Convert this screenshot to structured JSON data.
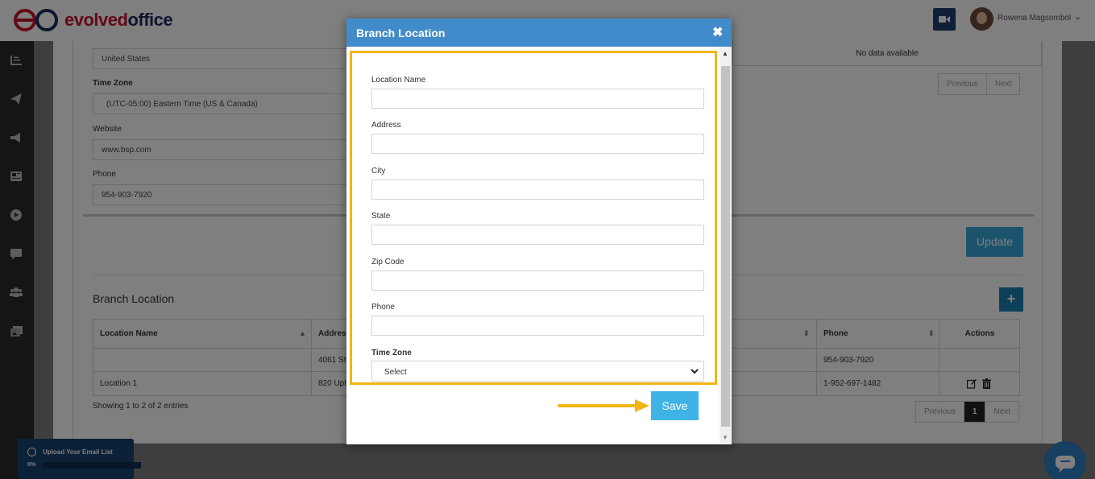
{
  "header": {
    "logo_prefix": "evolved",
    "logo_suffix": "office",
    "user_name": "Rowena Magsombol"
  },
  "sidebar": {
    "icons": [
      "dashboard-icon",
      "send-icon",
      "megaphone-icon",
      "newspaper-icon",
      "play-icon",
      "chat-icon",
      "users-icon",
      "gallery-icon"
    ]
  },
  "background_form": {
    "country_value": "United States",
    "time_zone_label": "Time Zone",
    "time_zone_value": "(UTC-05:00) Eastern Time (US & Canada)",
    "website_label": "Website",
    "website_value": "www.bsp.com",
    "phone_label": "Phone",
    "phone_value": "954-903-7920",
    "no_data": "No data available",
    "pager_top": {
      "previous": "Previous",
      "next": "Next"
    },
    "update_label": "Update"
  },
  "branch_section": {
    "title": "Branch Location",
    "add_label": "+",
    "columns": [
      "Location Name",
      "Addres",
      "Phone",
      "Actions"
    ],
    "rows": [
      {
        "name": "",
        "address": "4061 St",
        "phone": "954-903-7920"
      },
      {
        "name": "Location 1",
        "address": "820 Upl",
        "phone": "1-952-697-1482"
      }
    ],
    "entries_text": "Showing 1 to 2 of 2 entries",
    "pager": {
      "previous": "Previous",
      "page": "1",
      "next": "Next"
    }
  },
  "upload_widget": {
    "title": "Upload Your Email List",
    "percent": "0%",
    "progress": 0
  },
  "modal": {
    "title": "Branch Location",
    "close_label": "✖",
    "fields": {
      "location_name": {
        "label": "Location Name",
        "value": ""
      },
      "address": {
        "label": "Address",
        "value": ""
      },
      "city": {
        "label": "City",
        "value": ""
      },
      "state": {
        "label": "State",
        "value": ""
      },
      "zip": {
        "label": "Zip Code",
        "value": ""
      },
      "phone": {
        "label": "Phone",
        "value": ""
      },
      "time_zone": {
        "label": "Time Zone",
        "selected": "Select"
      }
    },
    "save_label": "Save"
  },
  "colors": {
    "modal_header": "#428bca",
    "highlight": "#f2b516",
    "save_button": "#3fb3e6",
    "update_button": "#39a6d8",
    "sidebar": "#2b2b2b"
  }
}
